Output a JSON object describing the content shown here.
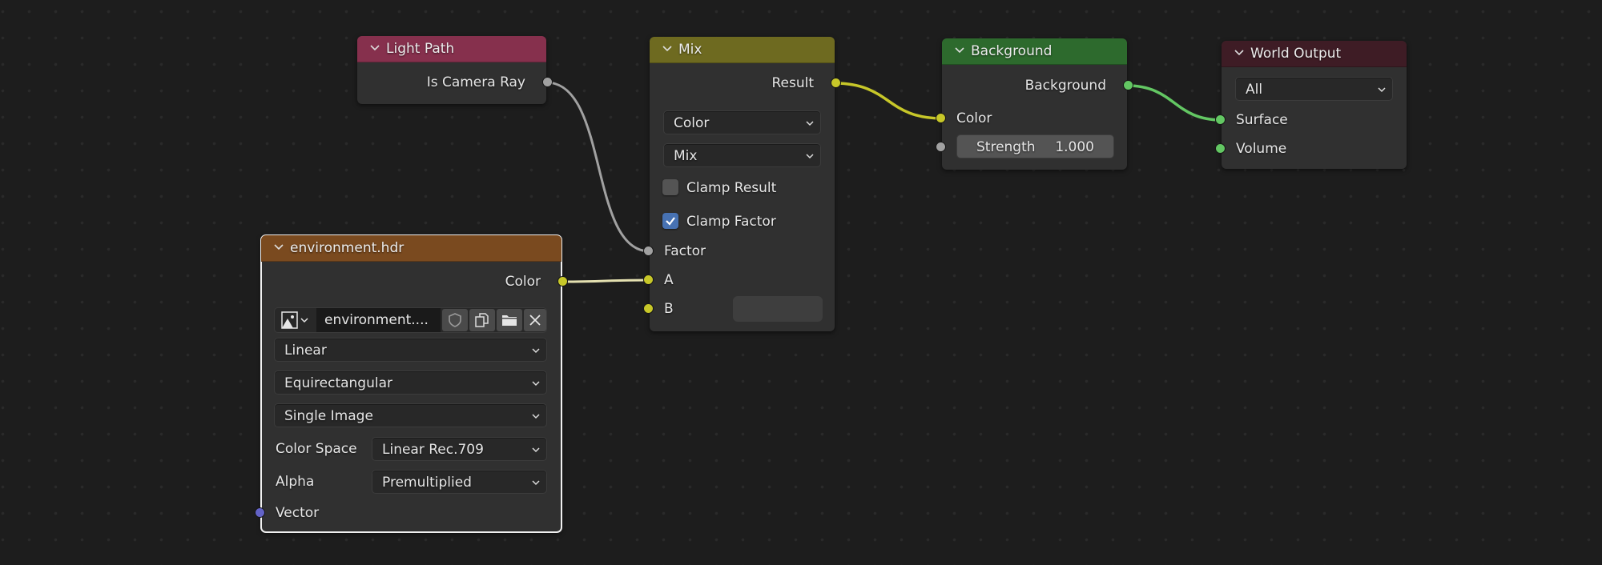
{
  "nodes": {
    "light_path": {
      "title": "Light Path",
      "header_color": "#86304d",
      "outputs": [
        {
          "label": "Is Camera Ray",
          "socket": "gray"
        }
      ]
    },
    "mix": {
      "title": "Mix",
      "header_color": "#6e6a20",
      "outputs": [
        {
          "label": "Result",
          "socket": "yellow"
        }
      ],
      "data_type": "Color",
      "blend_mode": "Mix",
      "clamp_result": {
        "label": "Clamp Result",
        "checked": false
      },
      "clamp_factor": {
        "label": "Clamp Factor",
        "checked": true
      },
      "inputs": [
        {
          "label": "Factor",
          "socket": "gray"
        },
        {
          "label": "A",
          "socket": "yellow"
        },
        {
          "label": "B",
          "socket": "yellow"
        }
      ]
    },
    "background": {
      "title": "Background",
      "header_color": "#2d6a2d",
      "outputs": [
        {
          "label": "Background",
          "socket": "green"
        }
      ],
      "inputs": [
        {
          "label": "Color",
          "socket": "yellow"
        },
        {
          "label": "Strength",
          "value": "1.000",
          "socket": "gray"
        }
      ]
    },
    "world_output": {
      "title": "World Output",
      "header_color": "#3e1c25",
      "target": "All",
      "inputs": [
        {
          "label": "Surface",
          "socket": "green"
        },
        {
          "label": "Volume",
          "socket": "green"
        }
      ]
    },
    "environment": {
      "title": "environment.hdr",
      "header_color": "#7a4a1f",
      "selected": true,
      "outputs": [
        {
          "label": "Color",
          "socket": "yellow"
        }
      ],
      "image_name": "environment....",
      "interpolation": "Linear",
      "projection": "Equirectangular",
      "source": "Single Image",
      "color_space_label": "Color Space",
      "color_space": "Linear Rec.709",
      "alpha_label": "Alpha",
      "alpha": "Premultiplied",
      "inputs": [
        {
          "label": "Vector",
          "socket": "blue"
        }
      ],
      "image_buttons": [
        "image-browse-icon",
        "fake-user-shield-icon",
        "duplicate-icon",
        "open-folder-icon",
        "unlink-x-icon"
      ]
    }
  },
  "links": [
    {
      "from": "light_path.Is Camera Ray",
      "to": "mix.Factor",
      "color": "#a1a1a1"
    },
    {
      "from": "environment.Color",
      "to": "mix.A",
      "color": "#e4e0b0"
    },
    {
      "from": "mix.Result",
      "to": "background.Color",
      "color": "#c7c729"
    },
    {
      "from": "background.Background",
      "to": "world_output.Surface",
      "color": "#63c763"
    }
  ]
}
